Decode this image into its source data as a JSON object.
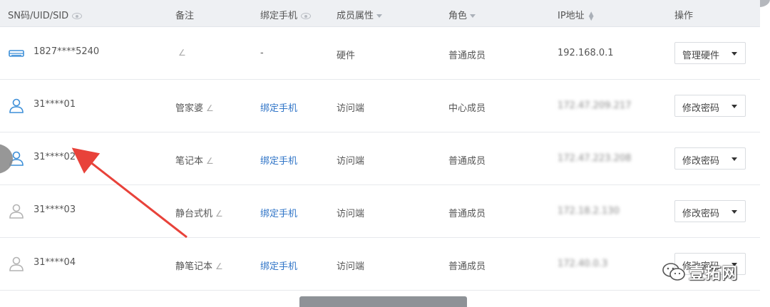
{
  "header": {
    "sn": "SN码/UID/SID",
    "remark": "备注",
    "phone": "绑定手机",
    "attr": "成员属性",
    "role": "角色",
    "ip": "IP地址",
    "op": "操作"
  },
  "rows": [
    {
      "sn": "1827****5240",
      "remark": "",
      "phone": "-",
      "attr": "硬件",
      "role": "普通成员",
      "ip": "192.168.0.1",
      "op": "管理硬件",
      "icon": "hardware-icon"
    },
    {
      "sn": "31****01",
      "remark": "管家婆",
      "phone": "绑定手机",
      "attr": "访问端",
      "role": "中心成员",
      "ip": "172.47.209.217",
      "op": "修改密码",
      "icon": "user-icon"
    },
    {
      "sn": "31****02",
      "remark": "笔记本",
      "phone": "绑定手机",
      "attr": "访问端",
      "role": "普通成员",
      "ip": "172.47.223.208",
      "op": "修改密码",
      "icon": "user-icon"
    },
    {
      "sn": "31****03",
      "remark": "静台式机",
      "phone": "绑定手机",
      "attr": "访问端",
      "role": "普通成员",
      "ip": "172.18.2.130",
      "op": "修改密码",
      "icon": "user-icon"
    },
    {
      "sn": "31****04",
      "remark": "静笔记本",
      "phone": "绑定手机",
      "attr": "访问端",
      "role": "普通成员",
      "ip": "172.40.0.3",
      "op": "修改密码",
      "icon": "user-icon"
    }
  ],
  "watermark": {
    "text": "壹拓网"
  },
  "colors": {
    "link": "#2f74c7",
    "header_bg": "#eef0f3",
    "arrow": "#e8423a",
    "user_active": "#3d8fd8",
    "user_inactive": "#b3b3b3"
  }
}
